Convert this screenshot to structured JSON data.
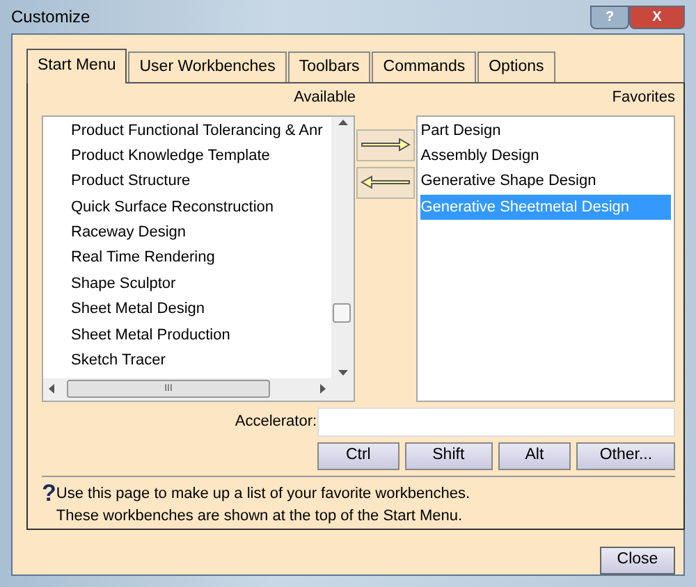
{
  "window": {
    "title": "Customize",
    "controls": [
      "?",
      "X"
    ]
  },
  "tabs": [
    {
      "label": "Start Menu",
      "selected": true
    },
    {
      "label": "User Workbenches",
      "selected": false
    },
    {
      "label": "Toolbars",
      "selected": false
    },
    {
      "label": "Commands",
      "selected": false
    },
    {
      "label": "Options",
      "selected": false
    }
  ],
  "available": {
    "heading": "Available",
    "items": [
      {
        "label": "Product Functional Tolerancing & Anr",
        "selected": false
      },
      {
        "label": "Product Knowledge Template",
        "selected": false
      },
      {
        "label": "Product Structure",
        "selected": false
      },
      {
        "label": "Quick Surface Reconstruction",
        "selected": false
      },
      {
        "label": "Raceway Design",
        "selected": false
      },
      {
        "label": "Real Time Rendering",
        "selected": false
      },
      {
        "label": "Shape Sculptor",
        "selected": false
      },
      {
        "label": "Sheet Metal Design",
        "selected": false
      },
      {
        "label": "Sheet Metal Production",
        "selected": false
      },
      {
        "label": "Sketch Tracer",
        "selected": false
      }
    ],
    "scrollbar_h_grip": "III"
  },
  "favorites": {
    "heading": "Favorites",
    "items": [
      {
        "label": "Part Design",
        "selected": false
      },
      {
        "label": "Assembly Design",
        "selected": false
      },
      {
        "label": "Generative Shape Design",
        "selected": false
      },
      {
        "label": "Generative Sheetmetal Design",
        "selected": true
      }
    ]
  },
  "accelerator": {
    "label": "Accelerator:",
    "buttons": [
      "Ctrl",
      "Shift",
      "Alt",
      "Other..."
    ]
  },
  "help": {
    "icon": "?",
    "lines": [
      "Use this page to make up a list of your favorite workbenches.",
      "These workbenches are shown at the top of the Start Menu."
    ]
  },
  "close_button": "Close"
}
